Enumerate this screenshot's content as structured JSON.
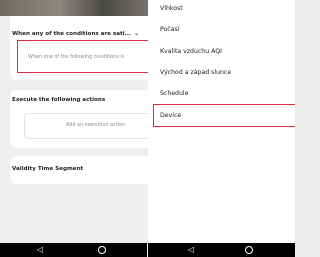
{
  "left_panel": {
    "condition_card": {
      "title": "When any of the conditions are sati...",
      "chevron": "⌄",
      "placeholder": "When one of the following conditions is"
    },
    "actions_card": {
      "title": "Execute the following actions",
      "button_label": "Add an execution action"
    },
    "validity_card": {
      "title": "Validity Time Segment"
    }
  },
  "menu": {
    "items": [
      {
        "label": "Vlhkost"
      },
      {
        "label": "Počasí"
      },
      {
        "label": "Kvalita vzduchu AQI"
      },
      {
        "label": "Východ a západ slunce"
      },
      {
        "label": "Schedule"
      },
      {
        "label": "Device"
      }
    ]
  },
  "navbar": {
    "back_glyph": "◁"
  },
  "colors": {
    "highlight": "#d92f3a",
    "placeholder_text": "#8a8a8a"
  },
  "icons": {
    "back": "triangle-back-icon",
    "home": "circle-home-icon"
  }
}
